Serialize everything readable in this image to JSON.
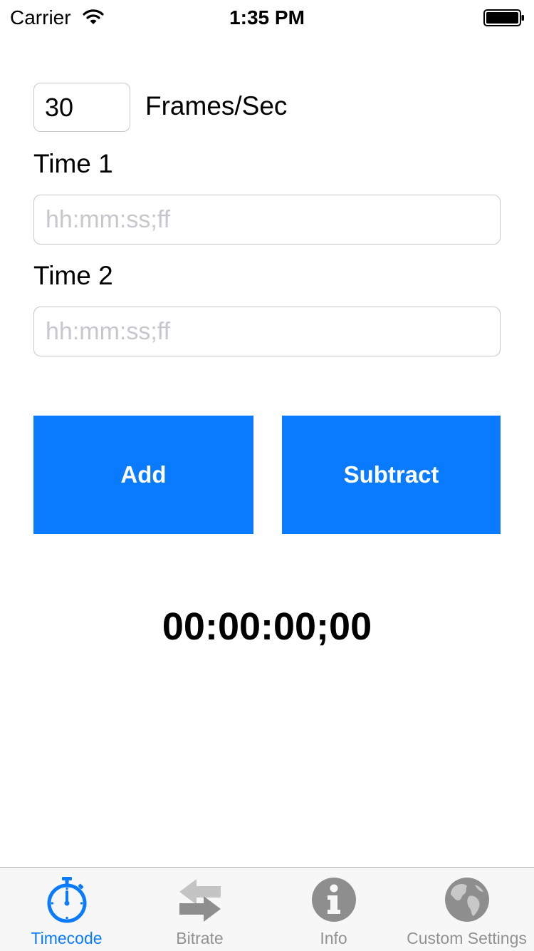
{
  "status_bar": {
    "carrier": "Carrier",
    "time": "1:35 PM"
  },
  "frames": {
    "value": "30",
    "label": "Frames/Sec"
  },
  "time1": {
    "label": "Time 1",
    "placeholder": "hh:mm:ss;ff",
    "value": ""
  },
  "time2": {
    "label": "Time 2",
    "placeholder": "hh:mm:ss;ff",
    "value": ""
  },
  "buttons": {
    "add": "Add",
    "subtract": "Subtract"
  },
  "result": "00:00:00;00",
  "tabs": [
    {
      "label": "Timecode",
      "icon": "stopwatch-icon",
      "active": true
    },
    {
      "label": "Bitrate",
      "icon": "swap-arrows-icon",
      "active": false
    },
    {
      "label": "Info",
      "icon": "info-icon",
      "active": false
    },
    {
      "label": "Custom Settings",
      "icon": "globe-icon",
      "active": false
    }
  ],
  "colors": {
    "accent": "#0a7bff",
    "tab_inactive": "#929292",
    "placeholder": "#c7c7cd"
  }
}
